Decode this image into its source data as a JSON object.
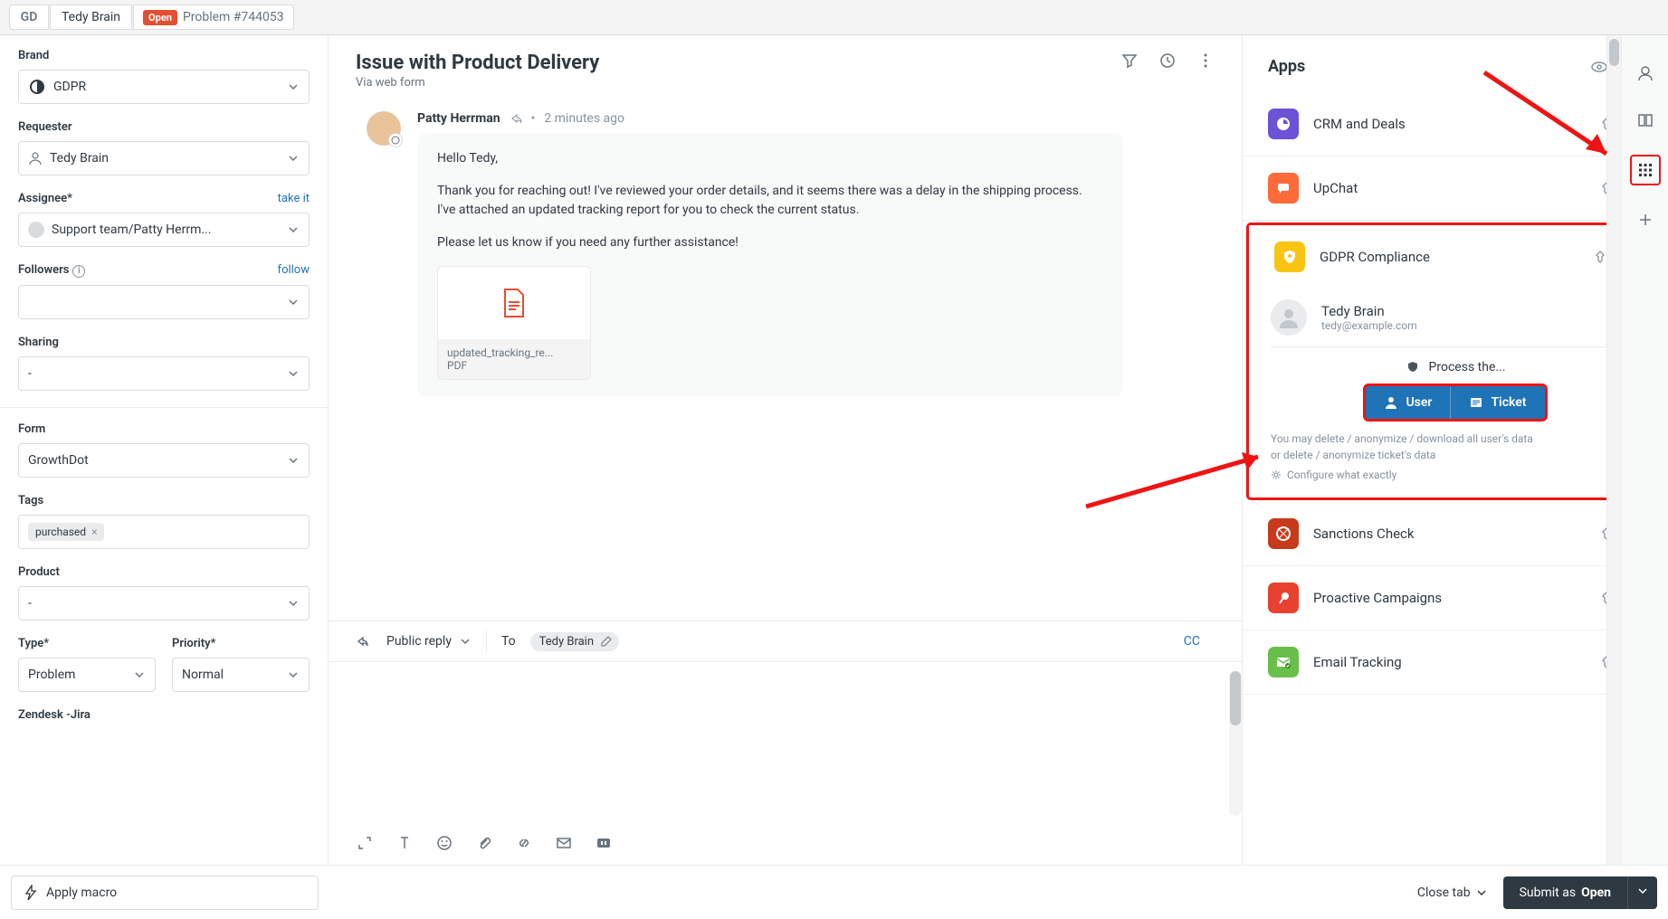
{
  "tabs": {
    "workspace": "GD",
    "user": "Tedy Brain",
    "badge": "Open",
    "ticket": "Problem #744053"
  },
  "left": {
    "brand_label": "Brand",
    "brand": "GDPR",
    "requester_label": "Requester",
    "requester": "Tedy Brain",
    "assignee_label": "Assignee*",
    "assignee_link": "take it",
    "assignee": "Support team/Patty Herrm...",
    "followers_label": "Followers",
    "followers_link": "follow",
    "followers": "",
    "sharing_label": "Sharing",
    "sharing": "-",
    "form_label": "Form",
    "form": "GrowthDot",
    "tags_label": "Tags",
    "tag1": "purchased",
    "product_label": "Product",
    "product": "-",
    "type_label": "Type*",
    "type": "Problem",
    "priority_label": "Priority*",
    "priority": "Normal",
    "jira_label": "Zendesk -Jira"
  },
  "conv": {
    "title": "Issue with Product Delivery",
    "sub": "Via web form",
    "author": "Patty Herrman",
    "time": "2 minutes ago",
    "body1": "Hello Tedy,",
    "body2": "Thank you for reaching out! I've reviewed your order details, and it seems there was a delay in the shipping process. I've attached an updated tracking report for you to check the current status.",
    "body3": "Please let us know if you need any further assistance!",
    "attach_name": "updated_tracking_re...",
    "attach_type": "PDF"
  },
  "composer": {
    "reply": "Public reply",
    "to": "To",
    "recipient": "Tedy Brain",
    "cc": "CC"
  },
  "apps": {
    "title": "Apps",
    "crm": "CRM and Deals",
    "upchat": "UpChat",
    "gdpr": "GDPR Compliance",
    "gdpr_user": "Tedy Brain",
    "gdpr_email": "tedy@example.com",
    "gdpr_process": "Process the...",
    "gdpr_btn_user": "User",
    "gdpr_btn_ticket": "Ticket",
    "gdpr_text1": "You may delete / anonymize / download all user's data",
    "gdpr_text2": "or delete / anonymize ticket's data",
    "gdpr_configure": "Configure what exactly",
    "sanctions": "Sanctions Check",
    "proactive": "Proactive Campaigns",
    "email": "Email Tracking"
  },
  "bottom": {
    "macro": "Apply macro",
    "close": "Close tab",
    "submit_pre": "Submit as ",
    "submit_status": "Open"
  }
}
